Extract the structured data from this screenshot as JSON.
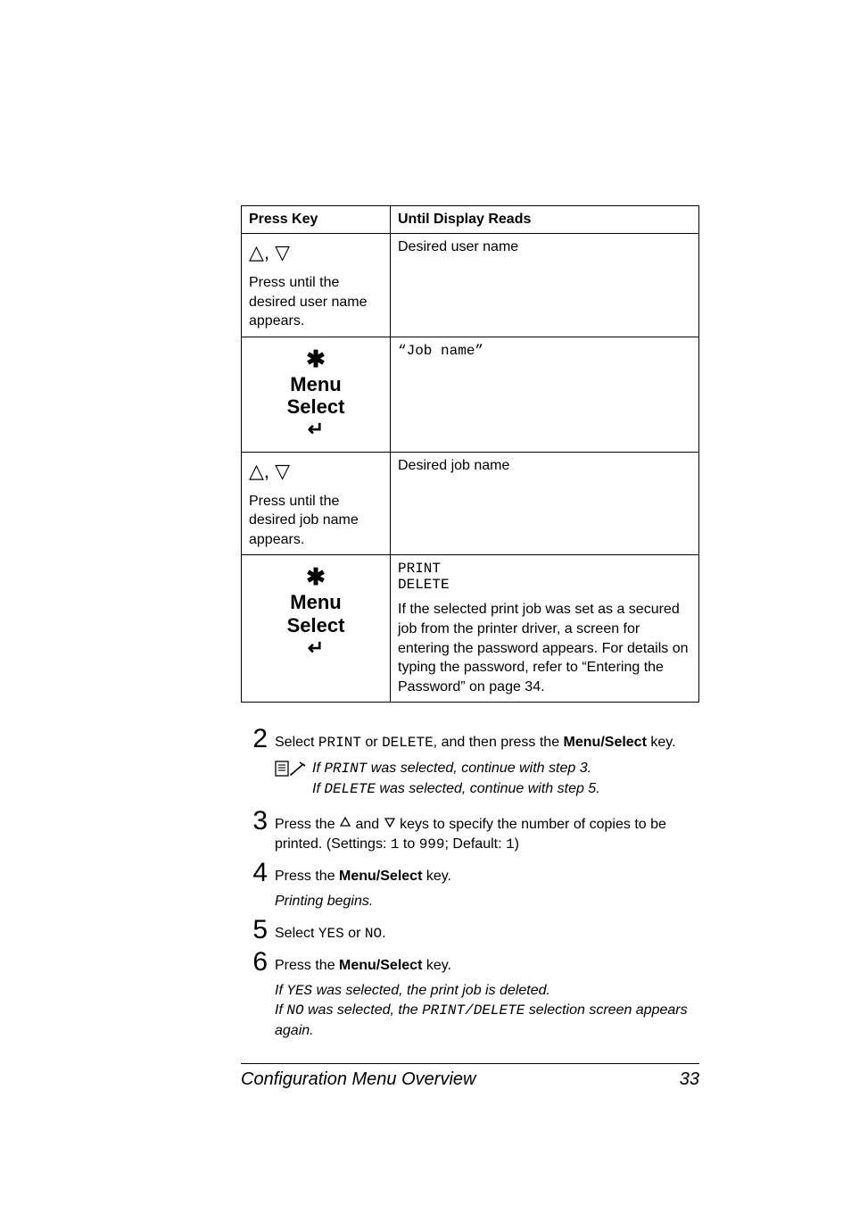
{
  "table": {
    "head": {
      "c1": "Press Key",
      "c2": "Until Display Reads"
    },
    "row1": {
      "arrows": "△, ▽",
      "sub": "Press until the desired user name appears.",
      "right": "Desired user name"
    },
    "row2": {
      "star": "✱",
      "menu": "Menu",
      "select": "Select",
      "enter": "↵",
      "right": "“Job name”"
    },
    "row3": {
      "arrows": "△, ▽",
      "sub": "Press until the desired job name appears.",
      "right": "Desired job name"
    },
    "row4": {
      "star": "✱",
      "menu": "Menu",
      "select": "Select",
      "enter": "↵",
      "right_l1": "PRINT",
      "right_l2": "DELETE",
      "right_para": "If the selected print job was set as a secured job from the printer driver, a screen for entering the password appears. For details on typing the password, refer to “Entering the Password” on page 34."
    }
  },
  "steps": {
    "s2": {
      "num": "2",
      "pre": "Select ",
      "m1": "PRINT",
      "mid": " or ",
      "m2": "DELETE",
      "post": ", and then press the ",
      "bold": "Menu/Select",
      "end": " key."
    },
    "note2": {
      "l1_pre": "If ",
      "l1_m": "PRINT",
      "l1_post": " was selected, continue with step 3.",
      "l2_pre": "If ",
      "l2_m": "DELETE",
      "l2_post": " was selected, continue with step 5."
    },
    "s3": {
      "num": "3",
      "pre": "Press the ",
      "mid": " and ",
      "post": " keys to specify the number of copies to be printed. (Settings: ",
      "m1": "1",
      "mid2": " to ",
      "m2": "999",
      "post2": "; Default: ",
      "m3": "1",
      "end": ")"
    },
    "s4": {
      "num": "4",
      "pre": "Press the ",
      "bold": "Menu/Select",
      "end": " key.",
      "sub": "Printing begins."
    },
    "s5": {
      "num": "5",
      "pre": "Select ",
      "m1": "YES",
      "mid": " or ",
      "m2": "NO",
      "end": "."
    },
    "s6": {
      "num": "6",
      "pre": "Press the ",
      "bold": "Menu/Select",
      "end": " key.",
      "sub1_pre": "If ",
      "sub1_m": "YES",
      "sub1_post": " was selected, the print job is deleted.",
      "sub2_pre": "If ",
      "sub2_m": "NO",
      "sub2_post": " was selected, the ",
      "sub2_m2": "PRINT",
      "sub2_slash": "/",
      "sub2_m3": "DELETE",
      "sub2_end": " selection screen appears again."
    }
  },
  "footer": {
    "title": "Configuration Menu Overview",
    "page": "33"
  }
}
